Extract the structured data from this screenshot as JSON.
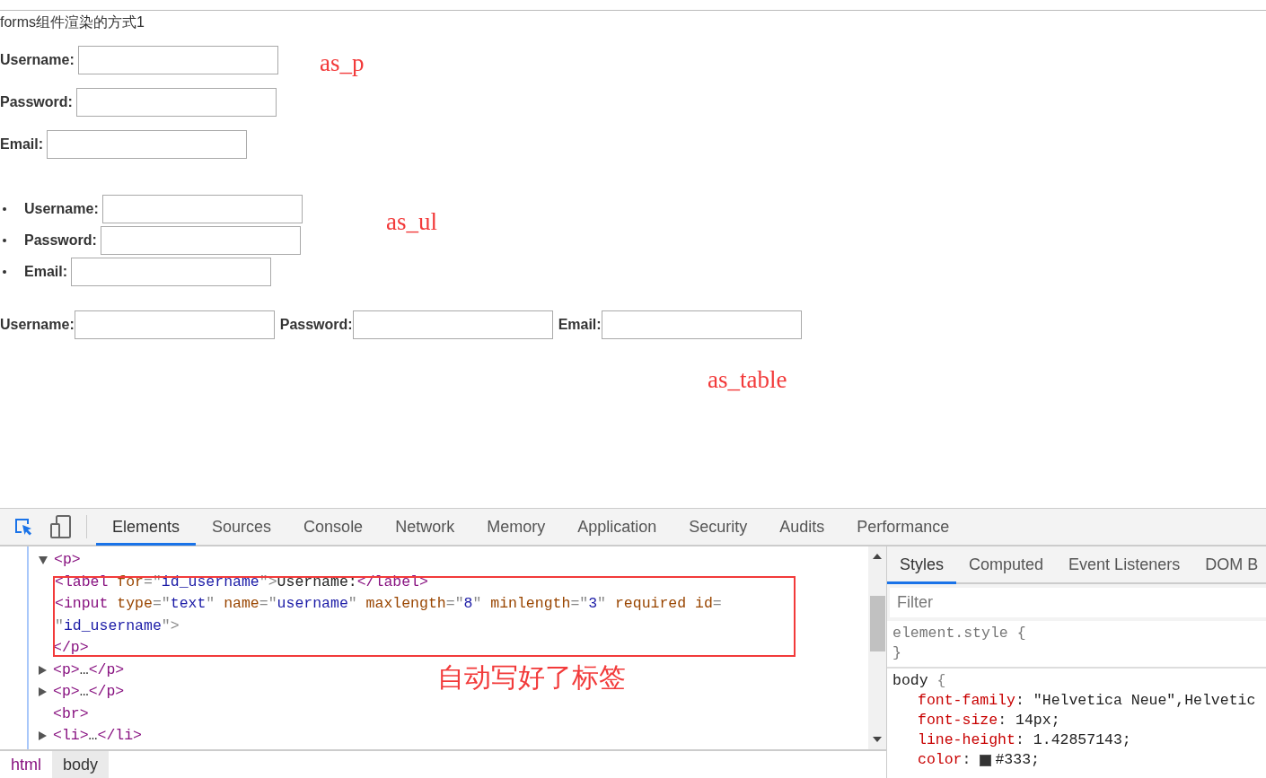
{
  "page": {
    "heading": "forms组件渲染的方式1",
    "as_p": [
      {
        "label": "Username:"
      },
      {
        "label": "Password:"
      },
      {
        "label": "Email:"
      }
    ],
    "as_ul": [
      {
        "label": "Username:"
      },
      {
        "label": "Password:"
      },
      {
        "label": "Email:"
      }
    ],
    "as_table": [
      {
        "label": "Username:"
      },
      {
        "label": "Password:"
      },
      {
        "label": "Email:"
      }
    ],
    "annotations": [
      {
        "kind": "as_p",
        "text": "as_p"
      },
      {
        "kind": "as_ul",
        "text": "as_ul"
      },
      {
        "kind": "as_table",
        "text": "as_table"
      },
      {
        "kind": "devtools",
        "text": "自动写好了标签"
      }
    ]
  },
  "devtools": {
    "tabs": [
      {
        "label": "Elements",
        "selected": true
      },
      {
        "label": "Sources",
        "selected": false
      },
      {
        "label": "Console",
        "selected": false
      },
      {
        "label": "Network",
        "selected": false
      },
      {
        "label": "Memory",
        "selected": false
      },
      {
        "label": "Application",
        "selected": false
      },
      {
        "label": "Security",
        "selected": false
      },
      {
        "label": "Audits",
        "selected": false
      },
      {
        "label": "Performance",
        "selected": false
      }
    ],
    "tree": [
      {
        "expanded": true,
        "open": [
          {
            "kind": "tag",
            "text": "<p>"
          }
        ],
        "children": [
          {
            "tokens": [
              {
                "kind": "tag",
                "text": "<label "
              },
              {
                "kind": "attr",
                "text": "for"
              },
              {
                "kind": "punct",
                "text": "=\""
              },
              {
                "kind": "value",
                "text": "id_username"
              },
              {
                "kind": "punct",
                "text": "\">"
              },
              {
                "kind": "text",
                "text": "Username:"
              },
              {
                "kind": "tag",
                "text": "</label>"
              }
            ]
          },
          {
            "tokens": [
              {
                "kind": "tag",
                "text": "<input "
              },
              {
                "kind": "attr",
                "text": "type"
              },
              {
                "kind": "punct",
                "text": "=\""
              },
              {
                "kind": "value",
                "text": "text"
              },
              {
                "kind": "punct",
                "text": "\" "
              },
              {
                "kind": "attr",
                "text": "name"
              },
              {
                "kind": "punct",
                "text": "=\""
              },
              {
                "kind": "value",
                "text": "username"
              },
              {
                "kind": "punct",
                "text": "\" "
              },
              {
                "kind": "attr",
                "text": "maxlength"
              },
              {
                "kind": "punct",
                "text": "=\""
              },
              {
                "kind": "value",
                "text": "8"
              },
              {
                "kind": "punct",
                "text": "\" "
              },
              {
                "kind": "attr",
                "text": "minlength"
              },
              {
                "kind": "punct",
                "text": "=\""
              },
              {
                "kind": "value",
                "text": "3"
              },
              {
                "kind": "punct",
                "text": "\" "
              },
              {
                "kind": "attr",
                "text": "required id"
              },
              {
                "kind": "punct",
                "text": "= \""
              },
              {
                "kind": "value",
                "text": "id_username"
              },
              {
                "kind": "punct",
                "text": "\">"
              }
            ]
          }
        ],
        "close": [
          {
            "kind": "tag",
            "text": "</p>"
          }
        ]
      },
      {
        "expanded": false,
        "open": [
          {
            "kind": "tag",
            "text": "<p>"
          },
          {
            "kind": "text",
            "text": "…"
          },
          {
            "kind": "tag",
            "text": "</p>"
          }
        ]
      },
      {
        "expanded": false,
        "open": [
          {
            "kind": "tag",
            "text": "<p>"
          },
          {
            "kind": "text",
            "text": "…"
          },
          {
            "kind": "tag",
            "text": "</p>"
          }
        ]
      },
      {
        "open": [
          {
            "kind": "tag",
            "text": "<br>"
          }
        ]
      },
      {
        "expanded": false,
        "open": [
          {
            "kind": "tag",
            "text": "<li>"
          },
          {
            "kind": "text",
            "text": "…"
          },
          {
            "kind": "tag",
            "text": "</li>"
          }
        ]
      }
    ],
    "breadcrumbs": [
      {
        "label": "html",
        "selected": false
      },
      {
        "label": "body",
        "selected": true
      }
    ],
    "side_tabs": [
      {
        "label": "Styles",
        "selected": true
      },
      {
        "label": "Computed",
        "selected": false
      },
      {
        "label": "Event Listeners",
        "selected": false
      },
      {
        "label": "DOM B",
        "selected": false
      }
    ],
    "filter": {
      "placeholder": "Filter"
    },
    "rules": [
      {
        "selector": "element.style",
        "kind": "inline",
        "open": "{",
        "close": "}"
      },
      {
        "selector": "body",
        "kind": "rule",
        "open": "{",
        "props": [
          {
            "name": "font-family",
            "sep": ":",
            "value": "\"Helvetica Neue\",Helvetic"
          },
          {
            "name": "font-size",
            "sep": ":",
            "value": "14px;"
          },
          {
            "name": "line-height",
            "sep": ":",
            "value": "1.42857143;"
          },
          {
            "name": "color",
            "sep": ":",
            "value": "#333;",
            "color": "#333333"
          }
        ]
      }
    ]
  }
}
